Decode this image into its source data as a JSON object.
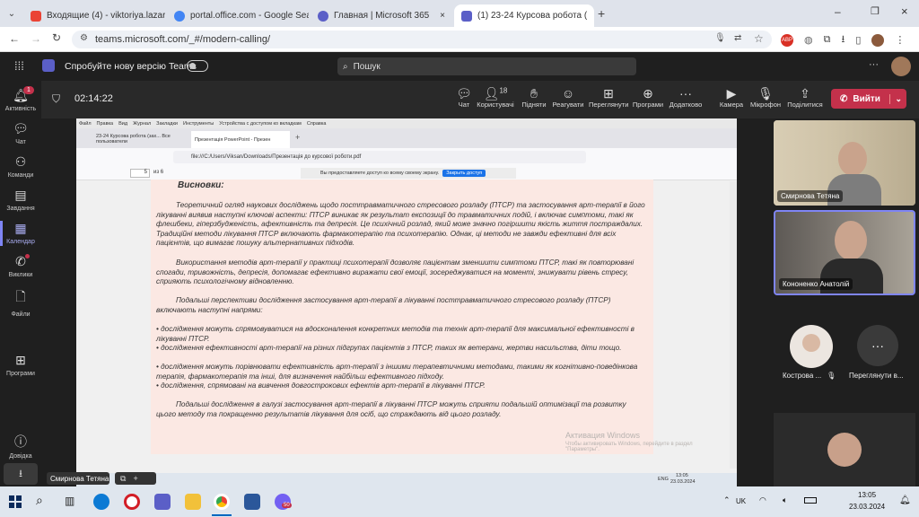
{
  "browser": {
    "tabs": [
      {
        "label": "Входящие (4) - viktoriya.lazaren",
        "favicon_color": "#ea4335"
      },
      {
        "label": "portal.office.com - Google Sear",
        "favicon_color": "#4285f4"
      },
      {
        "label": "Главная | Microsoft 365",
        "favicon_color": "#5b5fc7"
      },
      {
        "label": "(1) 23-24 Курсова робота (",
        "favicon_color": "#5b5fc7"
      }
    ],
    "url": "teams.microsoft.com/_#/modern-calling/"
  },
  "teams": {
    "try_new": "Спробуйте нову версію Teams",
    "search_placeholder": "Пошук",
    "rail": [
      {
        "label": "Активність",
        "icon": "bell-icon",
        "badge": "1"
      },
      {
        "label": "Чат",
        "icon": "chat-icon"
      },
      {
        "label": "Команди",
        "icon": "teams-icon"
      },
      {
        "label": "Завдання",
        "icon": "assignments-icon"
      },
      {
        "label": "Календар",
        "icon": "calendar-icon"
      },
      {
        "label": "Виклики",
        "icon": "phone-icon"
      },
      {
        "label": "Файли",
        "icon": "file-icon"
      },
      {
        "label": "Програми",
        "icon": "apps-icon"
      },
      {
        "label": "Довідка",
        "icon": "help-icon"
      }
    ],
    "timer": "02:14:22",
    "toolbar": [
      {
        "label": "Чат",
        "icon": "chat-icon"
      },
      {
        "label": "Користувачі",
        "icon": "people-icon",
        "count": "18"
      },
      {
        "label": "Підняти",
        "icon": "hand-icon"
      },
      {
        "label": "Реагувати",
        "icon": "smile-icon"
      },
      {
        "label": "Переглянути",
        "icon": "view-icon"
      },
      {
        "label": "Програми",
        "icon": "apps-icon"
      },
      {
        "label": "Додатково",
        "icon": "more-icon"
      },
      {
        "label": "Камера",
        "icon": "camera-off-icon"
      },
      {
        "label": "Мікрофон",
        "icon": "mic-icon"
      },
      {
        "label": "Поділитися",
        "icon": "share-icon"
      }
    ],
    "leave_label": "Вийти",
    "participants": [
      {
        "name": "Смирнова Тетяна"
      },
      {
        "name": "Кононенко Анатолій"
      },
      {
        "name": "Кострова ..."
      },
      {
        "name": "Переглянути в..."
      }
    ],
    "self_label": "Смирнова Тетяна"
  },
  "shared": {
    "menu": [
      "Файл",
      "Правка",
      "Вид",
      "Журнал",
      "Закладки",
      "Инструменты",
      "Устройства с доступом ко вкладкам",
      "Справка"
    ],
    "tabs": [
      "23-24 Курсова робота (зах... Все пользователи",
      "Презентація PowerPoint - Презен"
    ],
    "url": "file:///C:/Users/Viksan/Downloads/Презентація до курсової роботи.pdf",
    "page_current": "5",
    "page_total": "из 6",
    "share_notice": "Вы предоставляете доступ ко всему своему экрану.",
    "share_close": "Закрыть доступ",
    "heading": "Висновки:",
    "paragraphs": [
      "Теоретичний огляд наукових досліджень щодо посттравматичного стресового розладу (ПТСР) та застосування арт-терапії в його лікуванні виявив наступні ключові аспекти: ПТСР виникає як результат експозиції до травматичних подій, і включає симптоми, такі як флешбеки, гіперзбудженість, афективність та депресія. Це психічний розлад, який може значно погіршити якість життя постраждалих. Традиційні методи лікування ПТСР включають фармакотерапію та психотерапію. Однак, ці методи не завжди ефективні для всіх пацієнтів, що вимагає пошуку альтернативних підходів.",
      "Використання методів арт-терапії у практиці психотерапії дозволяє пацієнтам зменшити симптоми ПТСР, такі як повторювані спогади, тривожність, депресія, допомагає ефективно виражати свої емоції, зосереджуватися на моменті, знижувати рівень стресу, сприяють психологічному відновленню.",
      "Подальші перспективи дослідження застосування арт-терапії в лікуванні посттравматичного стресового розладу (ПТСР) включають наступні напрями:"
    ],
    "bullets": [
      "дослідження можуть спрямовуватися на вдосконалення конкретних методів та технік арт-терапії для максимальної ефективності в лікуванні ПТСР.",
      "дослідження ефективності арт-терапії на різних підгрупах пацієнтів з ПТСР, таких як ветерани, жертви насильства, діти тощо.",
      "дослідження можуть порівнювати ефективність арт-терапії з іншими терапевтичними методами, такими як когнітивно-поведінкова терапія, фармакотерапія та інші, для визначення найбільш ефективного підходу.",
      "дослідження, спрямовані на вивчення довгострокових ефектів арт-терапії в лікуванні ПТСР."
    ],
    "closing": "Подальші  дослідження в галузі застосування арт-терапії в лікуванні ПТСР можуть сприяти подальшій оптимізації та розвитку цього методу та покращенню результатів лікування для осіб, що страждають від цього розладу.",
    "watermark_title": "Активация Windows",
    "watermark_sub": "Чтобы активировать Windows, перейдите в раздел \"Параметры\".",
    "inner_taskbar_time": "13:05",
    "inner_taskbar_date": "23.03.2024",
    "inner_taskbar_lang": "ENG"
  },
  "taskbar": {
    "lang": "UK",
    "time": "13:05",
    "date": "23.03.2024",
    "notif_badge": "50"
  }
}
